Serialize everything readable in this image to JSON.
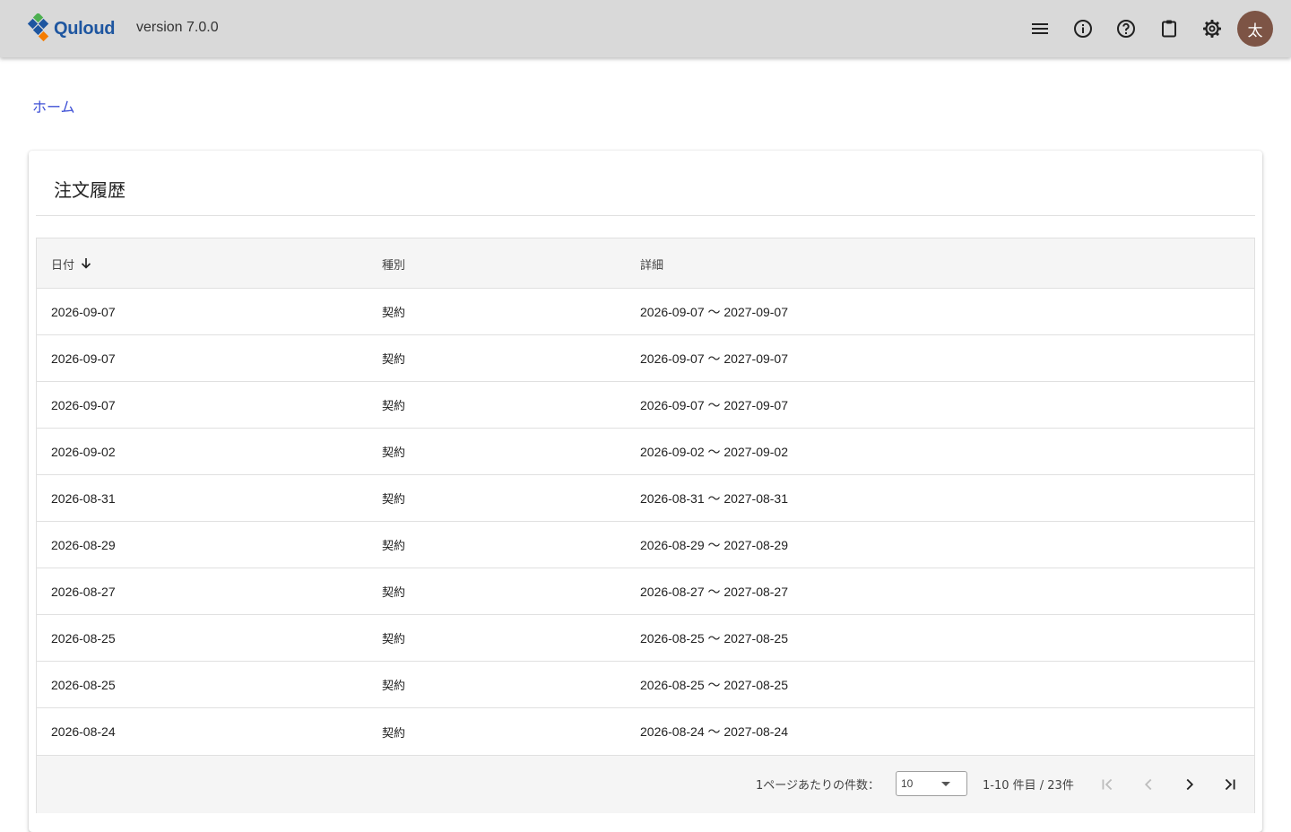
{
  "header": {
    "app_name": "Quloud",
    "version": "version 7.0.0",
    "avatar_initial": "太",
    "icons": [
      "menu-icon",
      "info-icon",
      "help-icon",
      "clipboard-icon",
      "settings-icon"
    ]
  },
  "breadcrumb": {
    "home": "ホーム"
  },
  "card": {
    "title": "注文履歴"
  },
  "table": {
    "columns": {
      "date": "日付",
      "type": "種別",
      "detail": "詳細"
    },
    "sort": {
      "column": "date",
      "direction": "descending"
    },
    "rows": [
      {
        "date": "2026-09-07",
        "type": "契約",
        "detail": "2026-09-07 ～ 2027-09-07"
      },
      {
        "date": "2026-09-07",
        "type": "契約",
        "detail": "2026-09-07 ～ 2027-09-07"
      },
      {
        "date": "2026-09-07",
        "type": "契約",
        "detail": "2026-09-07 ～ 2027-09-07"
      },
      {
        "date": "2026-09-02",
        "type": "契約",
        "detail": "2026-09-02 ～ 2027-09-02"
      },
      {
        "date": "2026-08-31",
        "type": "契約",
        "detail": "2026-08-31 ～ 2027-08-31"
      },
      {
        "date": "2026-08-29",
        "type": "契約",
        "detail": "2026-08-29 ～ 2027-08-29"
      },
      {
        "date": "2026-08-27",
        "type": "契約",
        "detail": "2026-08-27 ～ 2027-08-27"
      },
      {
        "date": "2026-08-25",
        "type": "契約",
        "detail": "2026-08-25 ～ 2027-08-25"
      },
      {
        "date": "2026-08-25",
        "type": "契約",
        "detail": "2026-08-25 ～ 2027-08-25"
      },
      {
        "date": "2026-08-24",
        "type": "契約",
        "detail": "2026-08-24 ～ 2027-08-24"
      }
    ]
  },
  "pagination": {
    "per_page_label": "1ページあたりの件数：",
    "per_page_value": "10",
    "range_text": "1-10 件目 / 23件"
  },
  "colors": {
    "topbar": "#d9d9d9",
    "brand": "#1e56a0",
    "link": "#3f51d6",
    "avatar": "#7d5445"
  }
}
